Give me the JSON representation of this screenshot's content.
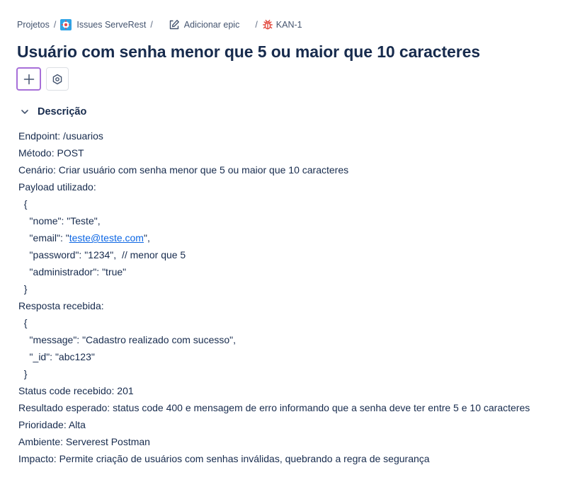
{
  "breadcrumb": {
    "projects": "Projetos",
    "project": "Issues ServeRest",
    "add_epic": "Adicionar epic",
    "issue_key": "KAN-1",
    "separator": "/"
  },
  "issue": {
    "title": "Usuário com senha menor que 5 ou maior que 10 caracteres"
  },
  "section": {
    "label": "Descrição"
  },
  "description": {
    "l1": "Endpoint: /usuarios",
    "l2": "Método: POST",
    "l3": "Cenário: Criar usuário com senha menor que 5 ou maior que 10 caracteres",
    "l4": "Payload utilizado:",
    "l5": "  {",
    "l6": "    \"nome\": \"Teste\",",
    "l7_pre": "    \"email\": \"",
    "l7_link": "teste@teste.com",
    "l7_post": "\",",
    "l8": "    \"password\": \"1234\",  // menor que 5",
    "l9": "    \"administrador\": \"true\"",
    "l10": "  }",
    "l11": "Resposta recebida:",
    "l12": "  {",
    "l13": "    \"message\": \"Cadastro realizado com sucesso\",",
    "l14": "    \"_id\": \"abc123\"",
    "l15": "  }",
    "l16": "Status code recebido: 201",
    "l17": "Resultado esperado: status code 400 e mensagem de erro informando que a senha deve ter entre 5 e 10 caracteres",
    "l18": "Prioridade: Alta",
    "l19": "Ambiente: Serverest Postman",
    "l20": "Impacto: Permite criação de usuários com senhas inválidas, quebrando a regra de segurança"
  },
  "icons": {
    "project": "project-avatar-icon",
    "epic": "edit-icon",
    "bug": "bug-icon",
    "add": "plus-icon",
    "settings": "gear-icon",
    "collapse": "chevron-down-icon"
  },
  "colors": {
    "text": "#172b4d",
    "muted": "#44546f",
    "link": "#0c66e4",
    "focus": "#a76fd8",
    "bug": "#e2483d"
  }
}
